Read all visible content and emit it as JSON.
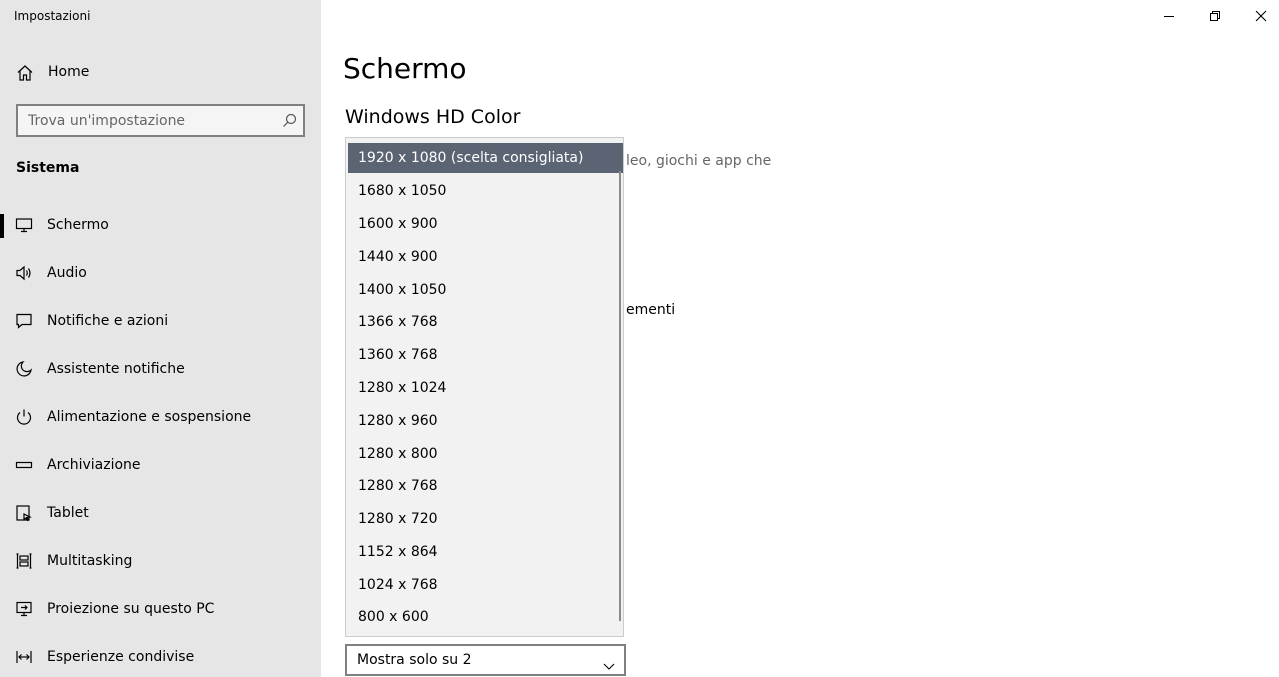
{
  "window": {
    "title": "Impostazioni"
  },
  "sidebar": {
    "home_label": "Home",
    "search_placeholder": "Trova un'impostazione",
    "section_title": "Sistema",
    "items": [
      {
        "label": "Schermo",
        "icon": "monitor-icon",
        "active": true
      },
      {
        "label": "Audio",
        "icon": "speaker-icon",
        "active": false
      },
      {
        "label": "Notifiche e azioni",
        "icon": "notification-icon",
        "active": false
      },
      {
        "label": "Assistente notifiche",
        "icon": "moon-icon",
        "active": false
      },
      {
        "label": "Alimentazione e sospensione",
        "icon": "power-icon",
        "active": false
      },
      {
        "label": "Archiviazione",
        "icon": "storage-icon",
        "active": false
      },
      {
        "label": "Tablet",
        "icon": "tablet-icon",
        "active": false
      },
      {
        "label": "Multitasking",
        "icon": "multitasking-icon",
        "active": false
      },
      {
        "label": "Proiezione su questo PC",
        "icon": "projection-icon",
        "active": false
      },
      {
        "label": "Esperienze condivise",
        "icon": "shared-experiences-icon",
        "active": false
      }
    ]
  },
  "main": {
    "title": "Schermo",
    "subtitle": "Windows HD Color",
    "partial_text_1": "leo, giochi e app che",
    "partial_text_2": "ementi"
  },
  "resolution_dropdown": {
    "selected_index": 0,
    "options": [
      "1920 x 1080 (scelta consigliata)",
      "1680 x 1050",
      "1600 x 900",
      "1440 x 900",
      "1400 x 1050",
      "1366 x 768",
      "1360 x 768",
      "1280 x 1024",
      "1280 x 960",
      "1280 x 800",
      "1280 x 768",
      "1280 x 720",
      "1152 x 864",
      "1024 x 768",
      "800 x 600"
    ]
  },
  "multiple_displays_select": {
    "value": "Mostra solo su 2"
  },
  "colors": {
    "sidebar_bg": "#e6e6e6",
    "selected_option_bg": "#5b6473",
    "accent": "#000000"
  }
}
